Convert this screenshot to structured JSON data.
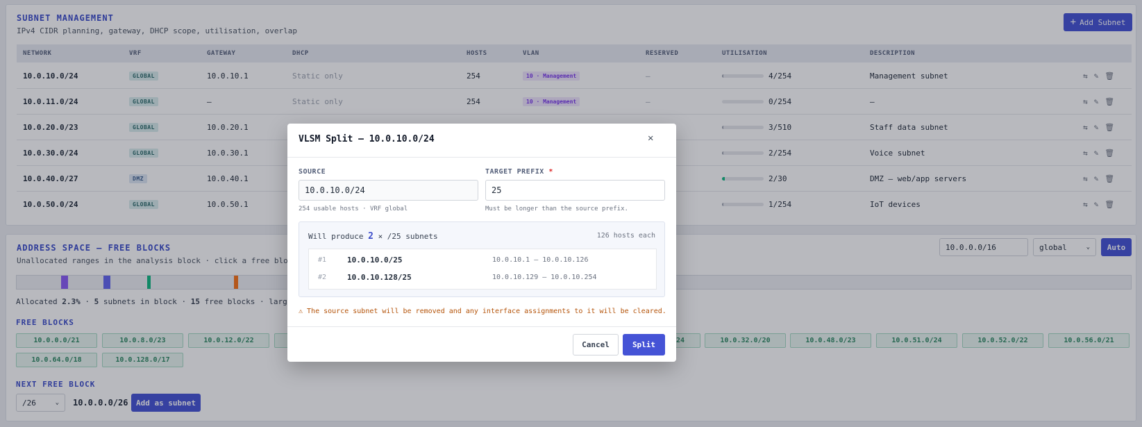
{
  "subnets": {
    "title": "SUBNET MANAGEMENT",
    "subtitle": "IPv4 CIDR planning, gateway, DHCP scope, utilisation, overlap",
    "add_label": "Add Subnet",
    "headers": [
      "NETWORK",
      "VRF",
      "GATEWAY",
      "DHCP",
      "HOSTS",
      "VLAN",
      "RESERVED",
      "UTILISATION",
      "DESCRIPTION"
    ],
    "rows": [
      {
        "network": "10.0.10.0/24",
        "vrf": "GLOBAL",
        "gateway": "10.0.10.1",
        "dhcp": "Static only",
        "hosts": "254",
        "vlan": "10 · Management",
        "reserved": "—",
        "util": "4/254",
        "util_fraction": 0.016,
        "description": "Management subnet"
      },
      {
        "network": "10.0.11.0/24",
        "vrf": "GLOBAL",
        "gateway": "—",
        "dhcp": "Static only",
        "hosts": "254",
        "vlan": "10 · Management",
        "reserved": "—",
        "util": "0/254",
        "util_fraction": 0,
        "description": "—"
      },
      {
        "network": "10.0.20.0/23",
        "vrf": "GLOBAL",
        "gateway": "10.0.20.1",
        "dhcp": "",
        "hosts": "",
        "vlan": "",
        "reserved": "",
        "util": "3/510",
        "util_fraction": 0.006,
        "description": "Staff data subnet"
      },
      {
        "network": "10.0.30.0/24",
        "vrf": "GLOBAL",
        "gateway": "10.0.30.1",
        "dhcp": "",
        "hosts": "",
        "vlan": "",
        "reserved": "",
        "util": "2/254",
        "util_fraction": 0.008,
        "description": "Voice subnet"
      },
      {
        "network": "10.0.40.0/27",
        "vrf": "DMZ",
        "gateway": "10.0.40.1",
        "dhcp": "",
        "hosts": "",
        "vlan": "",
        "reserved": "",
        "util": "2/30",
        "util_fraction": 0.067,
        "description": "DMZ — web/app servers"
      },
      {
        "network": "10.0.50.0/24",
        "vrf": "GLOBAL",
        "gateway": "10.0.50.1",
        "dhcp": "",
        "hosts": "",
        "vlan": "",
        "reserved": "",
        "util": "1/254",
        "util_fraction": 0.004,
        "description": "IoT devices"
      }
    ]
  },
  "space": {
    "title": "ADDRESS SPACE — FREE BLOCKS",
    "subtitle": "Unallocated ranges in the analysis block · click a free block to",
    "block_value": "10.0.0.0/16",
    "vrf_value": "global",
    "auto_label": "Auto",
    "stats": {
      "allocated_label": "Allocated",
      "allocated_value": "2.3%",
      "subnets_value": "5",
      "subnets_label": "subnets in block ·",
      "free_value": "15",
      "free_label": "free blocks · largest f"
    },
    "free_title": "FREE BLOCKS",
    "free_blocks_row1": [
      "10.0.0.0/21",
      "10.0.8.0/23",
      "10.0.12.0/22",
      "24",
      "10.0.32.0/20",
      "10.0.48.0/23",
      "10.0.51.0/24",
      "10.0.52.0/22",
      "10.0.56.0/21"
    ],
    "free_blocks_row2": [
      "10.0.64.0/18",
      "10.0.128.0/17"
    ],
    "next_title": "NEXT FREE BLOCK",
    "next_prefix": "/26",
    "next_value": "10.0.0.0/26",
    "next_add_label": "Add as subnet",
    "segment_colors": [
      "#8b5cf6",
      "#6366f1",
      "#10b981",
      "#f97316"
    ]
  },
  "modal": {
    "title": "VLSM Split — 10.0.10.0/24",
    "source_label": "SOURCE",
    "source_value": "10.0.10.0/24",
    "source_hint": "254 usable hosts · VRF global",
    "target_label": "TARGET PREFIX",
    "target_value": "25",
    "target_hint": "Must be longer than the source prefix.",
    "produce_prefix": "Will produce",
    "produce_count": "2",
    "produce_suffix": "× /25 subnets",
    "hosts_each": "126 hosts each",
    "results": [
      {
        "index": "#1",
        "network": "10.0.10.0/25",
        "range": "10.0.10.1 – 10.0.10.126"
      },
      {
        "index": "#2",
        "network": "10.0.10.128/25",
        "range": "10.0.10.129 – 10.0.10.254"
      }
    ],
    "warning": "⚠ The source subnet will be removed and any interface assignments to it will be cleared.",
    "cancel_label": "Cancel",
    "split_label": "Split"
  }
}
